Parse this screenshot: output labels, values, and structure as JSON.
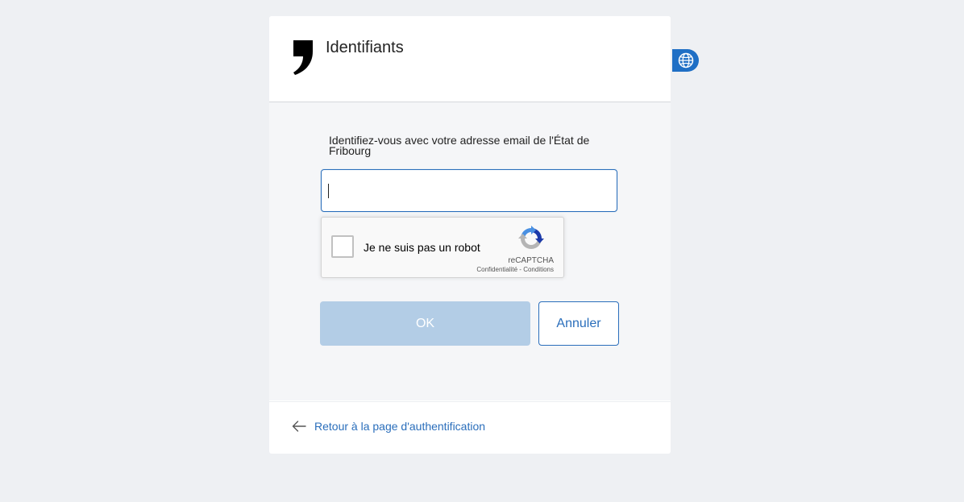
{
  "header": {
    "title": "Identifiants",
    "logo_icon": "comma-logo-icon"
  },
  "form": {
    "instruction": "Identifiez-vous avec votre adresse email de l'État de Fribourg",
    "email_value": "",
    "email_placeholder": ""
  },
  "recaptcha": {
    "label": "Je ne suis pas un robot",
    "brand": "reCAPTCHA",
    "privacy_link": "Confidentialité",
    "separator": " - ",
    "terms_link": "Conditions",
    "checked": false
  },
  "buttons": {
    "ok_label": "OK",
    "ok_disabled": true,
    "cancel_label": "Annuler"
  },
  "footer": {
    "back_link_label": "Retour à la page d'authentification",
    "back_icon": "arrow-left-icon"
  },
  "language": {
    "icon": "globe-icon"
  },
  "colors": {
    "accent": "#2a6ebb",
    "ok_disabled_bg": "#b3cde6",
    "page_bg": "#eef0f3",
    "body_bg": "#f5f6f8",
    "lang_bg": "#1f6fc5"
  }
}
